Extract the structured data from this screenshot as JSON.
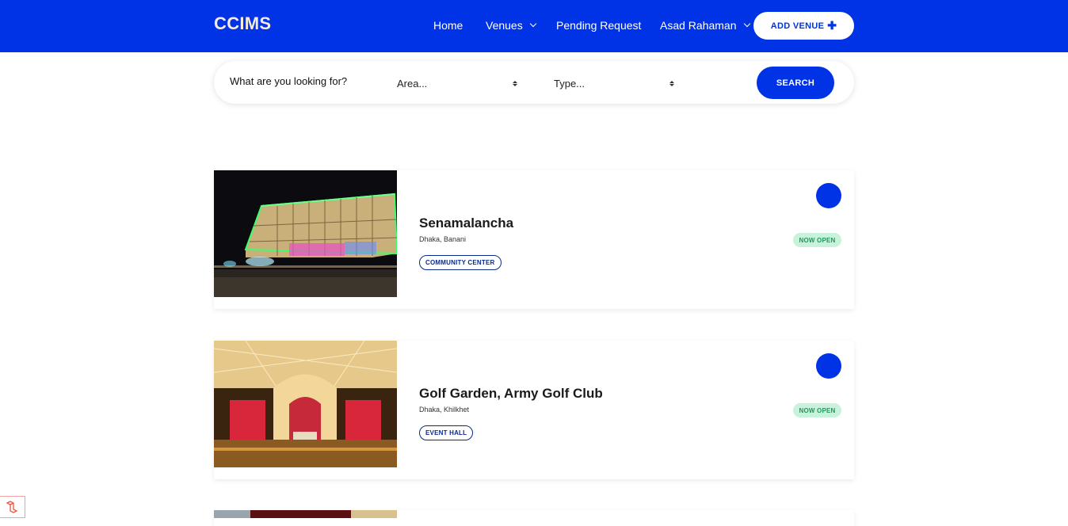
{
  "header": {
    "brand": "CCIMS",
    "nav": {
      "home": "Home",
      "venues": "Venues",
      "pending": "Pending Request",
      "user": "Asad Rahaman"
    },
    "add_venue": "ADD VENUE"
  },
  "search": {
    "prompt": "What are you looking for?",
    "area_placeholder": "Area...",
    "type_placeholder": "Type...",
    "button": "SEARCH"
  },
  "venues": [
    {
      "name": "Senamalancha",
      "location": "Dhaka, Banani",
      "type": "COMMUNITY CENTER",
      "status": "NOW OPEN"
    },
    {
      "name": "Golf Garden, Army Golf Club",
      "location": "Dhaka, Khilkhet",
      "type": "EVENT HALL",
      "status": "NOW OPEN"
    }
  ],
  "colors": {
    "primary": "#0033e6",
    "brand_text": "#f4eadd",
    "open_bg": "#c9f2dc",
    "open_text": "#1b9b58"
  },
  "icons": [
    "chevron-down-icon",
    "plus-icon",
    "select-arrows-icon",
    "laravel-icon"
  ]
}
